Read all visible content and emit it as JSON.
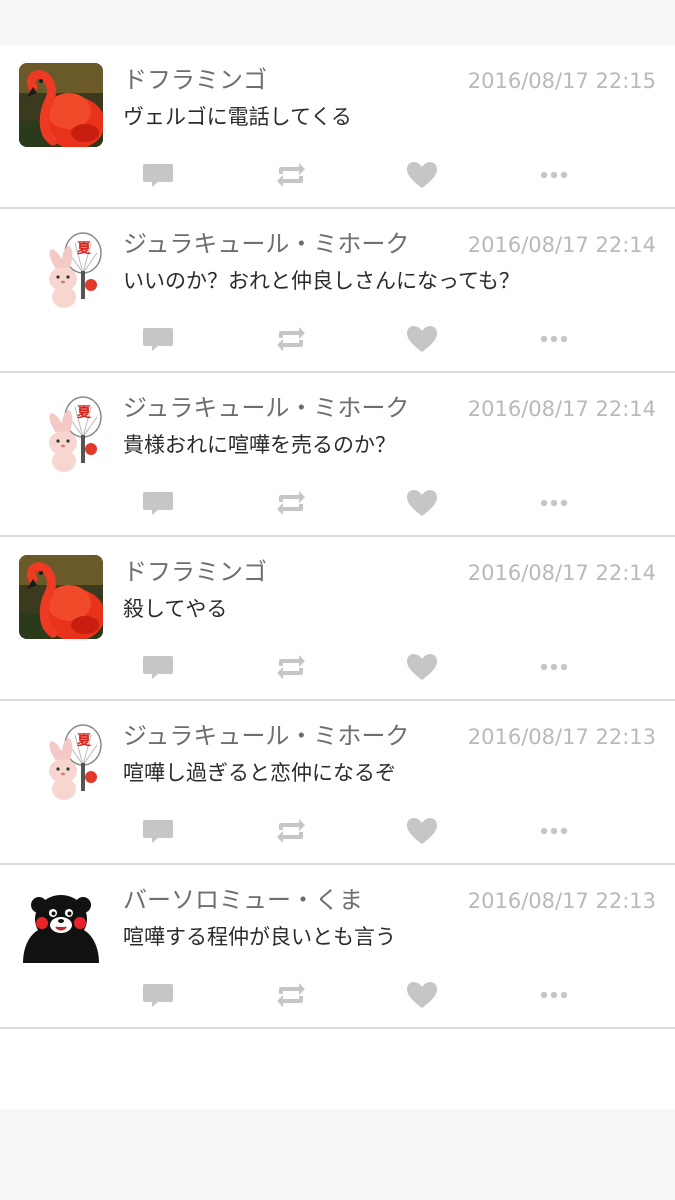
{
  "tweets": [
    {
      "name": "ドフラミンゴ",
      "time": "2016/08/17 22:15",
      "text": "ヴェルゴに電話してくる",
      "avatar": "flamingo-avatar"
    },
    {
      "name": "ジュラキュール・ミホーク",
      "time": "2016/08/17 22:14",
      "text": "いいのか？おれと仲良しさんになっても？",
      "avatar": "rabbit-fan-avatar"
    },
    {
      "name": "ジュラキュール・ミホーク",
      "time": "2016/08/17 22:14",
      "text": "貴様おれに喧嘩を売るのか？",
      "avatar": "rabbit-fan-avatar"
    },
    {
      "name": "ドフラミンゴ",
      "time": "2016/08/17 22:14",
      "text": "殺してやる",
      "avatar": "flamingo-avatar"
    },
    {
      "name": "ジュラキュール・ミホーク",
      "time": "2016/08/17 22:13",
      "text": "喧嘩し過ぎると恋仲になるぞ",
      "avatar": "rabbit-fan-avatar"
    },
    {
      "name": "バーソロミュー・くま",
      "time": "2016/08/17 22:13",
      "text": "喧嘩する程仲が良いとも言う",
      "avatar": "bear-mascot-avatar"
    }
  ],
  "icons": {
    "reply": "reply-icon",
    "retweet": "retweet-icon",
    "like": "heart-icon",
    "more": "more-icon"
  },
  "colors": {
    "background": "#f7f7f7",
    "card": "#ffffff",
    "divider": "#dcdcdc",
    "name": "#6e6e6e",
    "timestamp": "#b9b9b9",
    "text": "#2c2c2c",
    "action_icon": "#c6c6c6"
  }
}
